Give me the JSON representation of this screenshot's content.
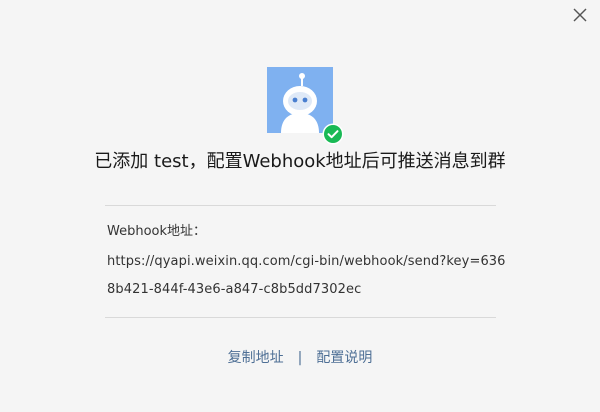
{
  "dialog": {
    "headline": "已添加 test，配置Webhook地址后可推送消息到群",
    "webhook_label": "Webhook地址：",
    "webhook_url": "https://qyapi.weixin.qq.com/cgi-bin/webhook/send?key=6368b421-844f-43e6-a847-c8b5dd7302ec",
    "actions": {
      "copy_label": "复制地址",
      "separator": "|",
      "help_label": "配置说明"
    }
  },
  "icons": {
    "close": "close-icon",
    "avatar": "robot-avatar",
    "badge": "check-circle-icon"
  },
  "colors": {
    "background": "#f5f5f5",
    "avatar_bg": "#7fb1f0",
    "badge_green": "#19b955",
    "link": "#4e6f95",
    "divider": "#d9d9d9"
  }
}
